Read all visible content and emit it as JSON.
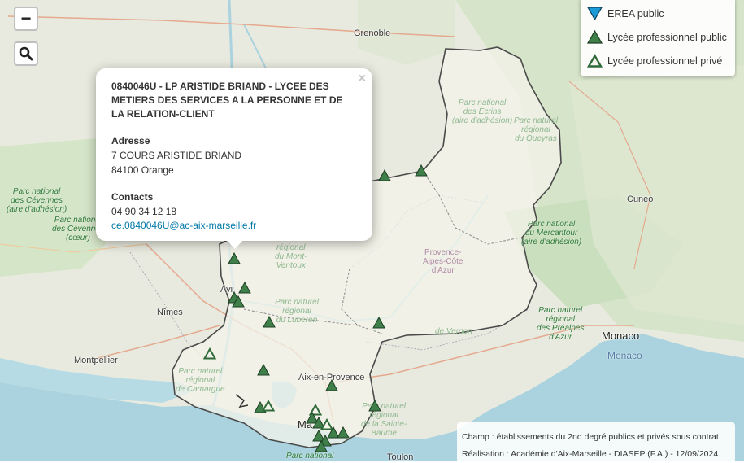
{
  "controls": {
    "zoom_out_label": "−",
    "search_icon": "magnifier-icon"
  },
  "legend": {
    "items": [
      {
        "label": "EREA public",
        "icon": "triangle-down-blue-icon",
        "color": "#1a9ad6"
      },
      {
        "label": "Lycée professionnel public",
        "icon": "triangle-green-filled-icon",
        "color": "#3f7f4a"
      },
      {
        "label": "Lycée professionnel privé",
        "icon": "triangle-green-outline-icon",
        "color": "#3f7f4a"
      }
    ]
  },
  "popup": {
    "title": "0840046U - LP ARISTIDE BRIAND - LYCEE DES METIERS DES SERVICES A LA PERSONNE ET DE LA RELATION-CLIENT",
    "close_label": "×",
    "address_label": "Adresse",
    "address_line1": "7 COURS ARISTIDE BRIAND",
    "address_line2": "84100 Orange",
    "contacts_label": "Contacts",
    "phone": "04 90 34 12 18",
    "email": "ce.0840046U@ac-aix-marseille.fr"
  },
  "map_labels": {
    "grenoble": "Grenoble",
    "cuneo": "Cuneo",
    "nimes": "Nîmes",
    "montpellier": "Montpellier",
    "avignon_fragment": "Avi",
    "aix": "Aix-en-Provence",
    "marseille_fragment": "Ma",
    "monaco": "Monaco",
    "monaco_sea": "Monaco",
    "toulon_fragment": "Toulon",
    "provence_region": "Provence-\nAlpes-Côte\nd'Azur",
    "park_ecrins": "Parc national\ndes Écrins\n(aire d'adhésion)",
    "park_queyras": "Parc naturel\nrégional\ndu Queyras",
    "park_cevennes_adh": "Parc national\ndes Cévennes\n(aire d'adhésion)",
    "park_cevennes_coeur": "Parc national\ndes Cévennes\n(cœur)",
    "park_ventoux": "régional\ndu Mont-\nVentoux",
    "park_luberon": "Parc naturel\nrégional\ndu Luberon",
    "park_verdon": "de Verdon",
    "park_mercantour": "Parc national\ndu Mercantour\n(aire d'adhésion)",
    "park_prealpes": "Parc naturel\nrégional\ndes Préalpes\nd'Azur",
    "park_camargue": "Parc naturel\nrégional\nde Camargue",
    "park_sainte_baume": "Parc naturel\nrégional\nde la Sainte-\nBaume",
    "park_calanques_fragment": "Parc national"
  },
  "attribution": {
    "line1": "Champ : établissements du 2nd degré publics et privés sous contrat",
    "line2": "Réalisation : Académie d'Aix-Marseille - DIASEP (F.A.) - 12/09/2024"
  }
}
